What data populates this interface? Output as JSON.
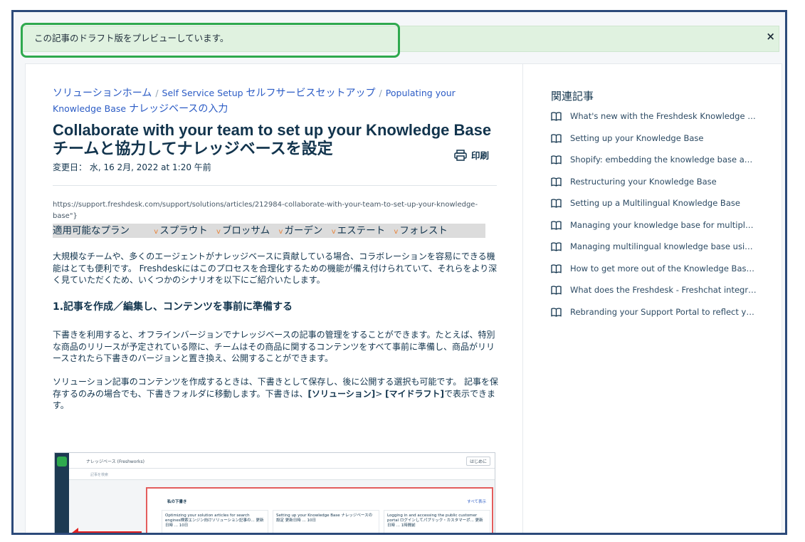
{
  "banner": {
    "text": "この記事のドラフト版をプレビューしています。",
    "close": "×"
  },
  "breadcrumb": {
    "items": [
      "ソリューションホーム",
      "Self Service Setup",
      "セルフサービスセットアップ",
      "Populating your Knowledge Base",
      "ナレッジベースの入力"
    ],
    "separator": "/"
  },
  "article": {
    "title_en": "Collaborate with your team to set up your Knowledge Base",
    "title_ja": "チームと協力してナレッジベースを設定",
    "print_label": "印刷",
    "modified": "変更日： 水, 16 2月, 2022 at 1:20 午前",
    "url": "https://support.freshdesk.com/support/solutions/articles/212984-collaborate-with-your-team-to-set-up-your-knowledge-base\"}",
    "plans_label": "適用可能なプラン",
    "plan_check": "v",
    "plans": [
      "スプラウト",
      "ブロッサム",
      "ガーデン",
      "エステート",
      "フォレスト"
    ],
    "intro": "大規模なチームや、多くのエージェントがナレッジベースに貢献している場合、コラボレーションを容易にできる機能はとても便利です。 Freshdeskにはこのプロセスを合理化するための機能が備え付けられていて、それらをより深く見ていただくため、いくつかのシナリオを以下にご紹介いたします。",
    "heading1": "1.記事を作成／編集し、コンテンツを事前に準備する",
    "para1": "下書きを利用すると、オフラインバージョンでナレッジベースの記事の管理をすることができます。たとえば、特別な商品のリリースが予定されている際に、チームはその商品に関するコンテンツをすべて事前に準備し、商品がリリースされたら下書きのバージョンと置き換え、公開することができます。",
    "para2_a": "ソリューション記事のコンテンツを作成するときは、下書きとして保存し、後に公開する選択も可能です。 記事を保存するのみの場合でも、下書きフォルダに移動します。下書きは、",
    "para2_b": "[ソリューション]",
    "para2_c": "> ",
    "para2_d": "[マイドラフト]",
    "para2_e": "で表示できます。"
  },
  "screenshot": {
    "app_title": "ナレッジベース (Freshworks)",
    "top_button": "はじめに",
    "search_placeholder": "記事を検索",
    "box_heading": "私の下書き",
    "box_all": "すべて表示",
    "cards": [
      "Optimizing your solution articles for search engines検索エンジン向けソリューション記事の...  更新日時 ... 10日",
      "Setting up your Knowledge Base  ナレッジベースの設定  更新日時 ... 10日",
      "Logging in and accessing the public customer portal  ログインしてパブリック・カスタマーポ...  更新日時 ... 1時間前"
    ]
  },
  "related": {
    "title": "関連記事",
    "items": [
      "What's new with the Freshdesk Knowledge Base?",
      "Setting up your Knowledge Base",
      "Shopify: embedding the knowledge base and widget",
      "Restructuring your Knowledge Base",
      "Setting up a Multilingual Knowledge Base",
      "Managing your knowledge base for multiple products",
      "Managing multilingual knowledge base using APIs",
      "How to get more out of the Knowledge Base content",
      "What does the Freshdesk - Freshchat integration do?",
      "Rebranding your Support Portal to reflect your brand"
    ]
  },
  "colors": {
    "banner_bg": "#e0f2e0",
    "highlight": "#2fa94e",
    "link": "#2c5cc5",
    "frame": "#2c4a7a",
    "check": "#e8833a"
  }
}
